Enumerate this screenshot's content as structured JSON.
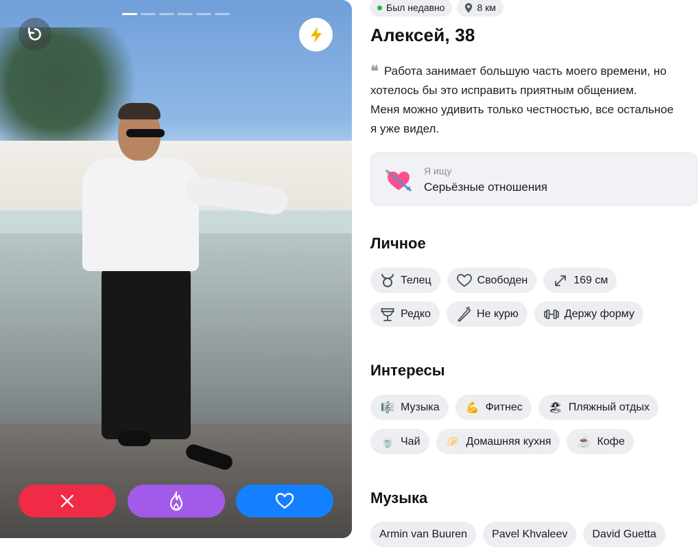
{
  "profile": {
    "status": "Был недавно",
    "distance": "8 км",
    "name_age": "Алексей, 38",
    "bio_line1": "Работа занимает большую часть моего времени, но",
    "bio_line2": "хотелось бы это исправить приятным общением.",
    "bio_line3": "Меня можно удивить только честностью, все остальное",
    "bio_line4": "я уже видел."
  },
  "looking_for": {
    "caption": "Я ищу",
    "value": "Серьёзные отношения"
  },
  "photo": {
    "count": 6,
    "current": 1
  },
  "sections": {
    "personal_title": "Личное",
    "interests_title": "Интересы",
    "music_title": "Музыка"
  },
  "personal": [
    {
      "label": "Телец",
      "icon": "taurus-icon"
    },
    {
      "label": "Свободен",
      "icon": "heart-outline-icon"
    },
    {
      "label": "169 см",
      "icon": "expand-icon"
    },
    {
      "label": "Редко",
      "icon": "glass-icon"
    },
    {
      "label": "Не курю",
      "icon": "no-smoking-icon"
    },
    {
      "label": "Держу форму",
      "icon": "dumbbell-icon"
    }
  ],
  "interests": [
    {
      "label": "Музыка",
      "emoji": "🎼"
    },
    {
      "label": "Фитнес",
      "emoji": "💪"
    },
    {
      "label": "Пляжный отдых",
      "emoji": "🏖"
    },
    {
      "label": "Чай",
      "emoji": "🍵"
    },
    {
      "label": "Домашняя кухня",
      "emoji": "🥟"
    },
    {
      "label": "Кофе",
      "emoji": "☕"
    }
  ],
  "music": [
    {
      "label": "Armin van Buuren"
    },
    {
      "label": "Pavel Khvaleev"
    },
    {
      "label": "David Guetta"
    }
  ],
  "colors": {
    "dislike": "#ef2b45",
    "super": "#a25be9",
    "like": "#1580ff",
    "online": "#2bb24c",
    "boost": "#f5b800"
  }
}
